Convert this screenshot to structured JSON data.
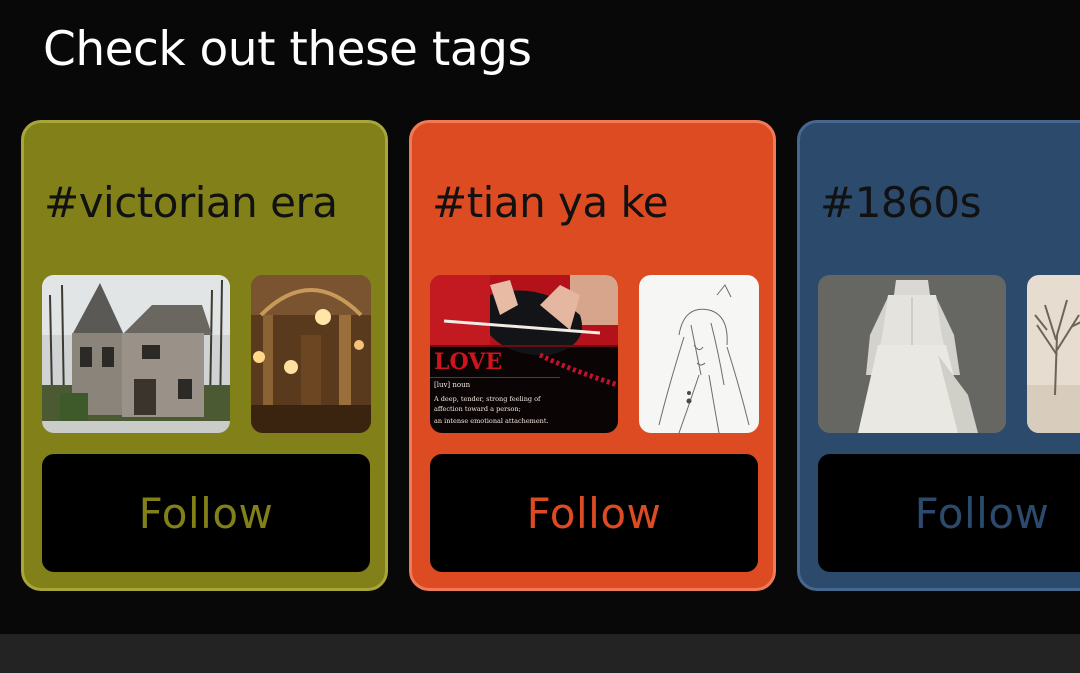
{
  "section": {
    "title": "Check out these tags"
  },
  "cards": [
    {
      "tag": "#victorian era",
      "follow_label": "Follow",
      "accent_color": "#828019",
      "images": [
        "abandoned-victorian-house-photo",
        "ornate-opera-interior-photo"
      ]
    },
    {
      "tag": "#tian ya ke",
      "follow_label": "Follow",
      "accent_color": "#dc4b22",
      "images": [
        "knitting-love-definition-image",
        "pencil-sketch-portrait-image"
      ],
      "image_text": {
        "word": "LOVE",
        "pronunciation": "[luv] noun",
        "line1": "A deep, tender, strong feeling of",
        "line2": "affection toward a person;",
        "line3": "an intense emotional attachement."
      }
    },
    {
      "tag": "#1860s",
      "follow_label": "Follow",
      "accent_color": "#2c4a6c",
      "images": [
        "white-victorian-dress-photo",
        "sepia-tree-photo"
      ]
    }
  ]
}
